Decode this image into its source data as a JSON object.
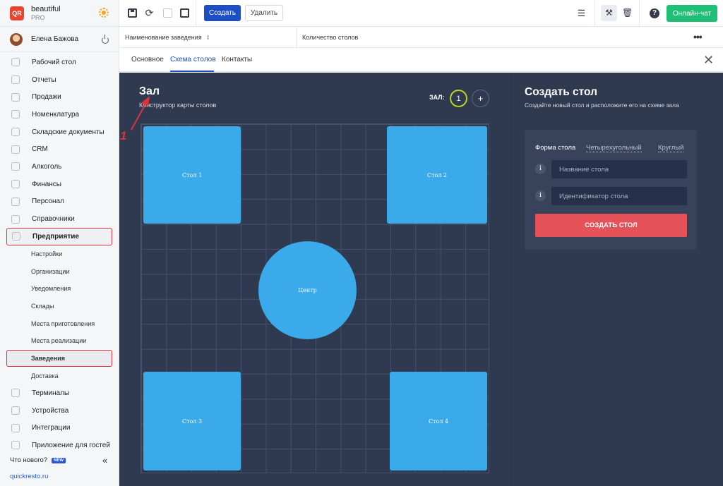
{
  "brand": {
    "name": "beautiful",
    "plan": "PRO",
    "logo_text": "QR"
  },
  "user": {
    "name": "Елена Бажова"
  },
  "sidebar": {
    "items": [
      {
        "label": "Рабочий стол",
        "icon": "dashboard-icon"
      },
      {
        "label": "Отчеты",
        "icon": "chart-icon"
      },
      {
        "label": "Продажи",
        "icon": "cart-icon"
      },
      {
        "label": "Номенклатура",
        "icon": "tag-icon"
      },
      {
        "label": "Складские документы",
        "icon": "archive-icon"
      },
      {
        "label": "CRM",
        "icon": "people-icon"
      },
      {
        "label": "Алкоголь",
        "icon": "glass-icon"
      },
      {
        "label": "Финансы",
        "icon": "wallet-icon"
      },
      {
        "label": "Персонал",
        "icon": "person-icon"
      },
      {
        "label": "Справочники",
        "icon": "book-icon"
      },
      {
        "label": "Предприятие",
        "icon": "building-icon"
      }
    ],
    "sub_items": [
      "Настройки",
      "Организации",
      "Уведомления",
      "Склады",
      "Места приготовления",
      "Места реализации",
      "Заведения",
      "Доставка"
    ],
    "items_after": [
      {
        "label": "Терминалы",
        "icon": "terminal-icon"
      },
      {
        "label": "Устройства",
        "icon": "printer-icon"
      },
      {
        "label": "Интеграции",
        "icon": "link-icon"
      },
      {
        "label": "Приложение для гостей",
        "icon": "phone-icon"
      }
    ],
    "whats_new": "Что нового?",
    "new_badge": "NEW",
    "collapse_glyph": "«",
    "site": "quickresto.ru"
  },
  "toolbar": {
    "create_label": "Создать",
    "delete_label": "Удалить",
    "chat_label": "Онлайн-чат",
    "help_glyph": "?"
  },
  "columns": {
    "col1": "Наименование заведения",
    "col2": "Количество столов",
    "more_glyph": "•••"
  },
  "tabs": [
    {
      "label": "Основное"
    },
    {
      "label": "Схема столов"
    },
    {
      "label": "Контакты"
    }
  ],
  "editor": {
    "title": "Зал",
    "subtitle": "Конструктор карты столов",
    "hall_label": "ЗАЛ:",
    "hall_number": "1",
    "add_glyph": "+",
    "tables": [
      {
        "label": "Стол 1",
        "shape": "square"
      },
      {
        "label": "Стол 2",
        "shape": "square"
      },
      {
        "label": "Центр",
        "shape": "round"
      },
      {
        "label": "Стол 3",
        "shape": "square"
      },
      {
        "label": "Стол 4",
        "shape": "square"
      }
    ]
  },
  "annotation": {
    "number": "1",
    "color": "#e0323b"
  },
  "panel": {
    "title": "Создать стол",
    "description": "Создайте новый стол и расположите его на схеме зала",
    "shape_label": "Форма стола",
    "shape_options": [
      "Четырехугольный",
      "Круглый"
    ],
    "name_placeholder": "Название стола",
    "id_placeholder": "Идентификатор стола",
    "submit_label": "СОЗДАТЬ СТОЛ",
    "info_glyph": "i"
  },
  "colors": {
    "accent": "#1e4fc2",
    "chat": "#1fbf75",
    "table": "#3aaaea",
    "canvas": "#2f3a51",
    "danger": "#e5525a"
  }
}
